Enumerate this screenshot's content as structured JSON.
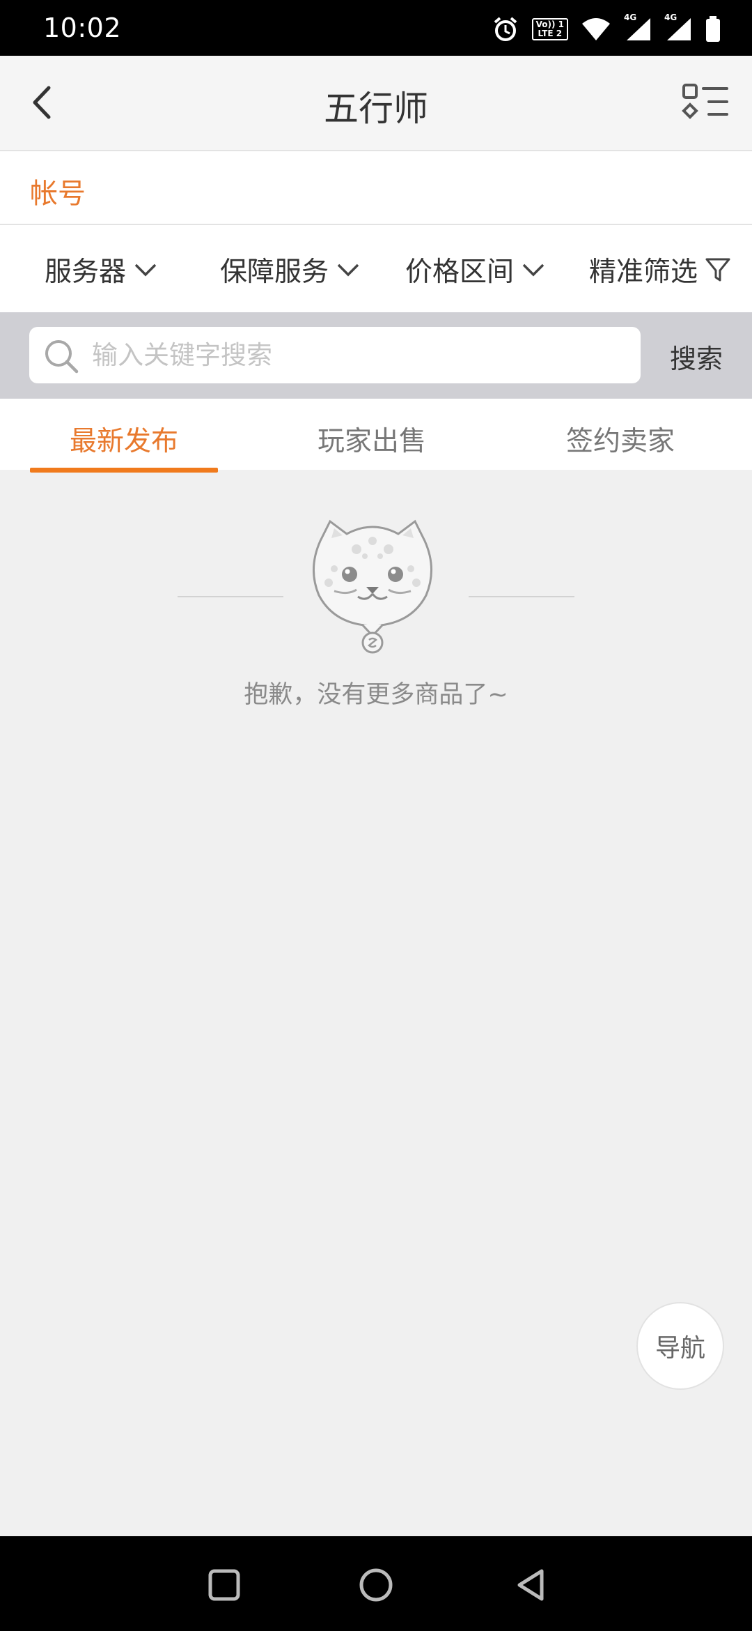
{
  "status_bar": {
    "time": "10:02",
    "volte_line1": "Vo)) 1",
    "volte_line2": "LTE 2",
    "network_label_1": "4G",
    "network_label_2": "4G",
    "icons": [
      "alarm-icon",
      "volte-icon",
      "wifi-icon",
      "signal-icon",
      "signal-icon",
      "battery-icon"
    ]
  },
  "header": {
    "title": "五行师",
    "back_icon": "chevron-left-icon",
    "menu_icon": "category-list-icon"
  },
  "account": {
    "label": "帐号"
  },
  "filters": [
    {
      "label": "服务器",
      "icon": "chevron-down-icon"
    },
    {
      "label": "保障服务",
      "icon": "chevron-down-icon"
    },
    {
      "label": "价格区间",
      "icon": "chevron-down-icon"
    },
    {
      "label": "精准筛选",
      "icon": "filter-icon"
    }
  ],
  "search": {
    "placeholder": "输入关键字搜索",
    "value": "",
    "button_label": "搜索"
  },
  "tabs": [
    {
      "label": "最新发布",
      "active": true
    },
    {
      "label": "玩家出售",
      "active": false
    },
    {
      "label": "签约卖家",
      "active": false
    }
  ],
  "empty_state": {
    "message": "抱歉，没有更多商品了~",
    "illustration": "leopard-mascot-icon"
  },
  "nav_button": {
    "label": "导航"
  },
  "colors": {
    "accent": "#e8792d",
    "tab_indicator": "#f07a1c",
    "background": "#f0f0f0",
    "search_strip": "#cfcfd4"
  },
  "system_nav": [
    "recents-square-icon",
    "home-circle-icon",
    "back-triangle-icon"
  ]
}
